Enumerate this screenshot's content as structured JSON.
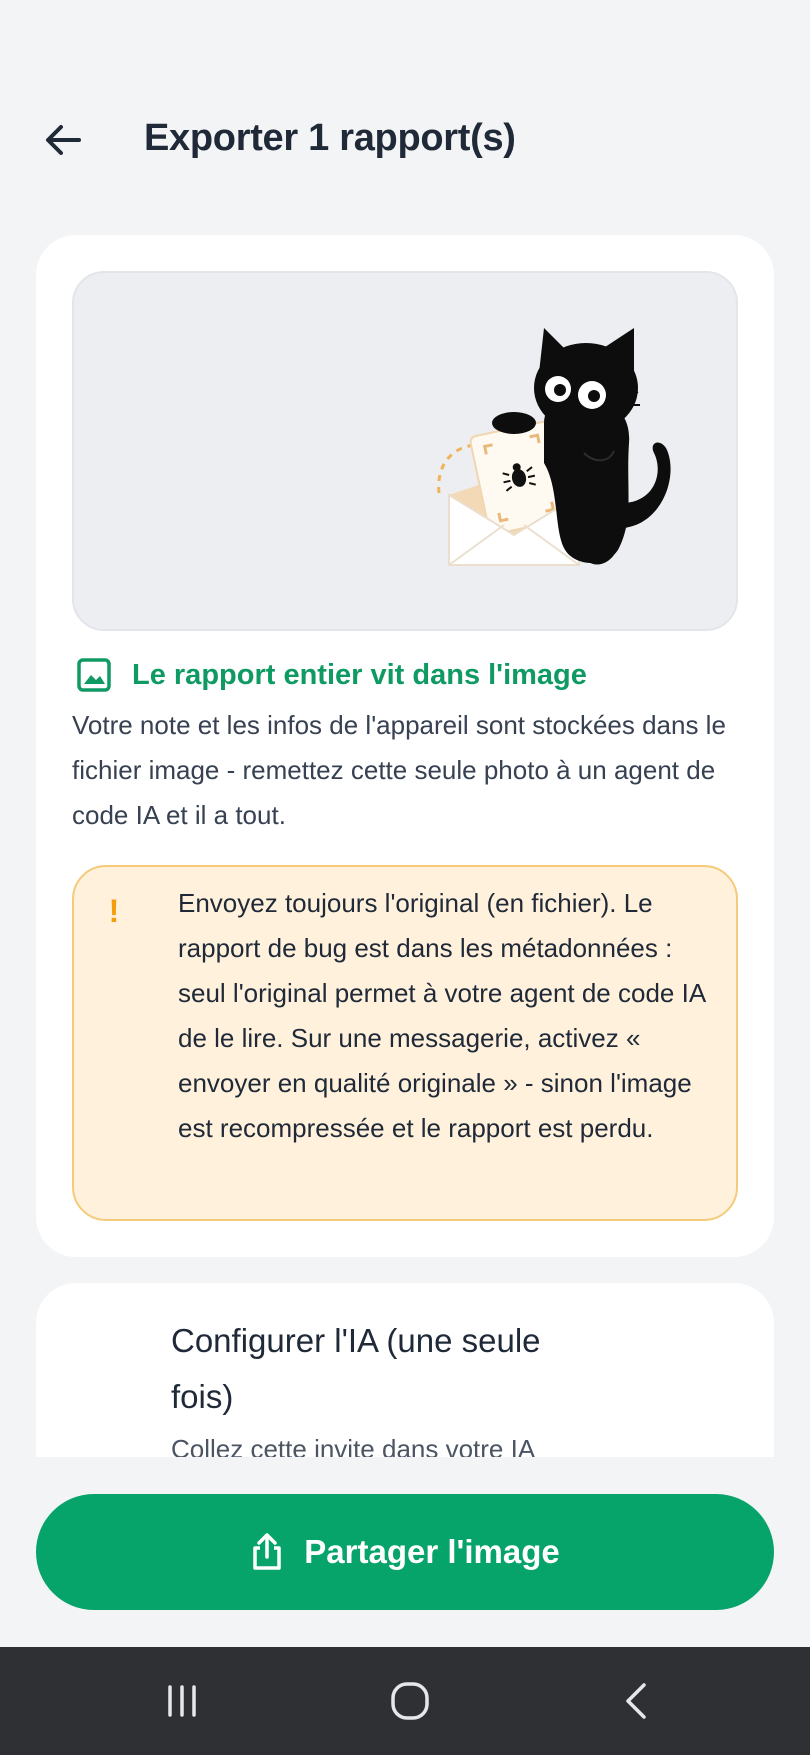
{
  "header": {
    "title": "Exporter 1 rapport(s)",
    "back_icon": "arrow-left-icon"
  },
  "preview": {
    "illustration": "cat-with-envelope-illustration"
  },
  "info": {
    "icon": "image-icon",
    "title": "Le rapport entier vit dans l'image",
    "body": "Votre note et les infos de l'appareil sont stockées dans le fichier image - remettez cette seule photo à un agent de code IA et il a tout."
  },
  "warning": {
    "icon": "exclamation-icon",
    "text": "Envoyez toujours l'original (en fichier). Le rapport de bug est dans les métadonnées : seul l'original permet à votre agent de code IA de le lire. Sur une messagerie, activez « envoyer en qualité originale » - sinon l'image est recompressée et le rapport est perdu."
  },
  "setup": {
    "title": "Configurer l'IA (une seule fois)",
    "subtitle": "Collez cette invite dans votre IA"
  },
  "share": {
    "label": "Partager l'image",
    "icon": "share-icon"
  },
  "navbar": {
    "recents_icon": "recents-icon",
    "home_icon": "home-icon",
    "back_icon": "back-chevron-icon"
  },
  "colors": {
    "accent": "#06a46a",
    "info_title": "#109a63",
    "warning_bg": "#fff1dc",
    "warning_border": "#f5cb7a",
    "warning_icon": "#f59e0b"
  }
}
